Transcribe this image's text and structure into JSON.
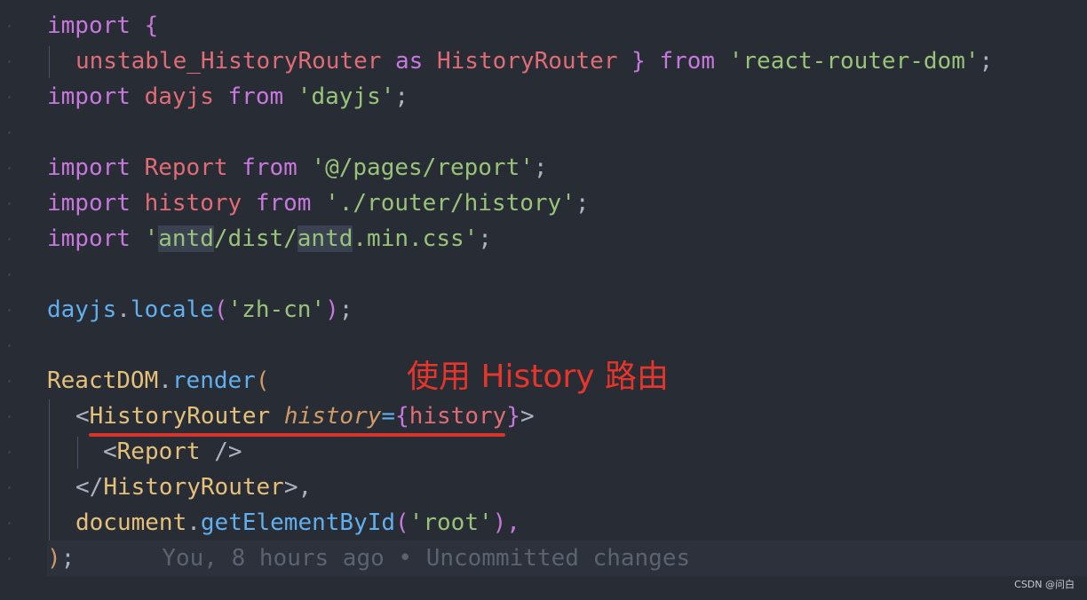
{
  "code_lines": [
    {
      "t1": "import",
      "t2": " {"
    },
    {
      "t1": "unstable_HistoryRouter",
      "t2": " as ",
      "t3": "HistoryRouter",
      "t4": " } ",
      "t5": "from",
      "t6": " ",
      "t7": "'react-router-dom'",
      "t8": ";"
    },
    {
      "t1": "import",
      "t2": " ",
      "t3": "dayjs",
      "t4": " ",
      "t5": "from",
      "t6": " ",
      "t7": "'dayjs'",
      "t8": ";"
    },
    {},
    {
      "t1": "import",
      "t2": " ",
      "t3": "Report",
      "t4": " ",
      "t5": "from",
      "t6": " ",
      "t7": "'@/pages/report'",
      "t8": ";"
    },
    {
      "t1": "import",
      "t2": " ",
      "t3": "history",
      "t4": " ",
      "t5": "from",
      "t6": " ",
      "t7": "'./router/history'",
      "t8": ";"
    },
    {
      "t1": "import",
      "t2": " ",
      "t3": "'",
      "t4": "antd",
      "t5": "/dist/",
      "t6": "antd",
      "t7": ".min.css'",
      "t8": ";"
    },
    {},
    {
      "t1": "dayjs",
      "t2": ".",
      "t3": "locale",
      "t4": "(",
      "t5": "'zh-cn'",
      "t6": ")",
      "t7": ";"
    },
    {},
    {
      "t1": "ReactDOM",
      "t2": ".",
      "t3": "render",
      "t4": "("
    },
    {
      "t1": "<",
      "t2": "HistoryRouter",
      "t3": " ",
      "t4": "history",
      "t5": "=",
      "t6": "{",
      "t7": "history",
      "t8": "}",
      "t9": ">"
    },
    {
      "t1": "<",
      "t2": "Report",
      "t3": " />"
    },
    {
      "t1": "</",
      "t2": "HistoryRouter",
      "t3": ">,"
    },
    {
      "t1": "document",
      "t2": ".",
      "t3": "getElementById",
      "t4": "(",
      "t5": "'root'",
      "t6": "),"
    },
    {
      "t1": ")",
      "t2": ";"
    }
  ],
  "blame": "You, 8 hours ago • Uncommitted changes",
  "annotation": "使用 History 路由",
  "watermark": "CSDN @问白",
  "colors": {
    "background": "#282c34",
    "keyword": "#c678dd",
    "variable": "#e06c75",
    "string": "#98c379",
    "function": "#61afef",
    "class": "#e5c07b",
    "attribute": "#d19a66",
    "annotation_red": "#e6352b"
  }
}
